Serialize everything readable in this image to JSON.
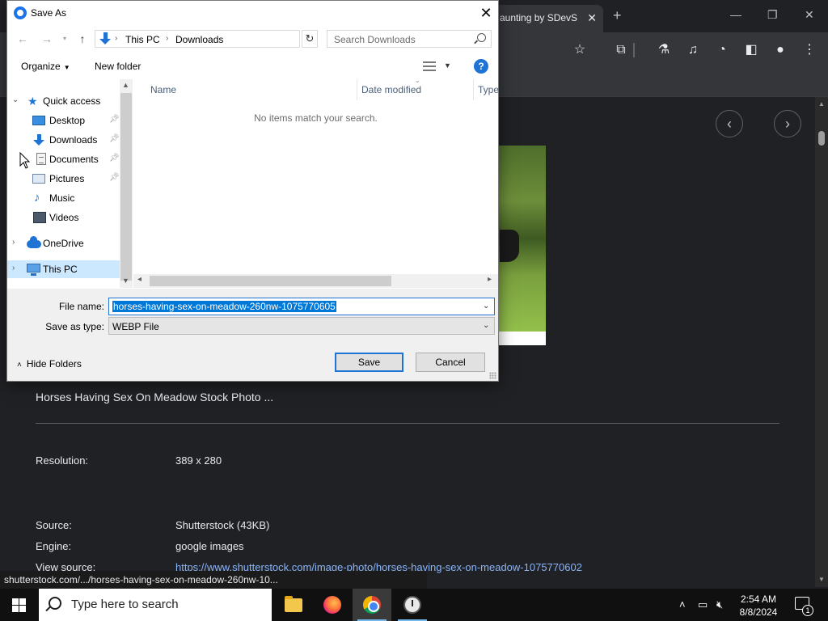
{
  "browser": {
    "tab_title": "aunting by SDevS",
    "tab_close": "✕",
    "new_tab": "+"
  },
  "page": {
    "prev_icon": "‹",
    "next_icon": "›",
    "image_title": "Horses Having Sex On Meadow Stock Photo ...",
    "resolution_label": "Resolution:",
    "resolution_value": "389 x 280",
    "source_label": "Source:",
    "source_value": "Shutterstock (43KB)",
    "engine_label": "Engine:",
    "engine_value": "google images",
    "view_source_label": "View source:",
    "view_source_link": "https://www.shutterstock.com/image-photo/horses-having-sex-on-meadow-1075770602",
    "status_url": "shutterstock.com/.../horses-having-sex-on-meadow-260nw-10..."
  },
  "dialog": {
    "title": "Save As",
    "close": "✕",
    "breadcrumb": [
      "This PC",
      "Downloads"
    ],
    "search_placeholder": "Search Downloads",
    "organize": "Organize",
    "new_folder": "New folder",
    "help": "?",
    "nav_tree": {
      "quick_access": "Quick access",
      "desktop": "Desktop",
      "downloads": "Downloads",
      "documents": "Documents",
      "pictures": "Pictures",
      "music": "Music",
      "videos": "Videos",
      "onedrive": "OneDrive",
      "this_pc": "This PC"
    },
    "columns": {
      "name": "Name",
      "date_modified": "Date modified",
      "type": "Type"
    },
    "empty_message": "No items match your search.",
    "file_name_label": "File name:",
    "file_name_value": "horses-having-sex-on-meadow-260nw-1075770605",
    "save_type_label": "Save as type:",
    "save_type_value": "WEBP File",
    "hide_folders": "Hide Folders",
    "save": "Save",
    "cancel": "Cancel"
  },
  "taskbar": {
    "search_placeholder": "Type here to search",
    "time": "2:54 AM",
    "date": "8/8/2024",
    "notification_count": "1"
  },
  "colors": {
    "accent": "#0078d7",
    "link": "#8ab4f8",
    "page_bg": "#202124"
  }
}
